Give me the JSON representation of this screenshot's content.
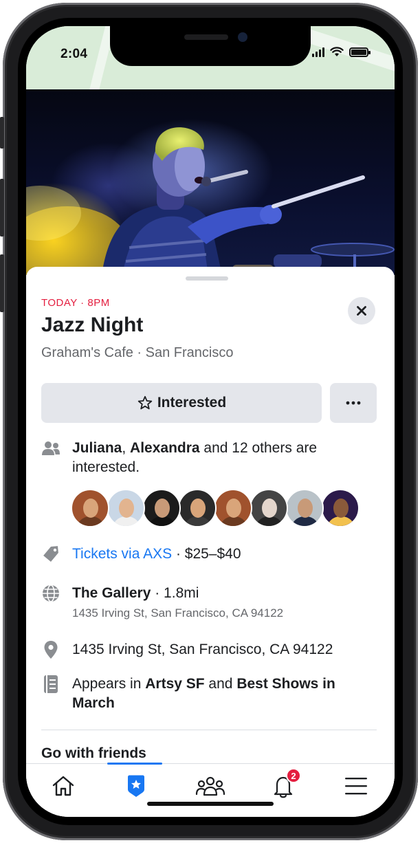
{
  "status_bar": {
    "time": "2:04"
  },
  "event": {
    "when": "TODAY · 8PM",
    "title": "Jazz Night",
    "subtitle": "Graham's Cafe · San Francisco"
  },
  "actions": {
    "interested_label": "Interested",
    "more_label": "···"
  },
  "interest": {
    "name1": "Juliana",
    "sep": ", ",
    "name2": "Alexandra",
    "rest": " and 12 others are interested."
  },
  "avatars": [
    {
      "name": "avatar-1",
      "bg": "#a0522d",
      "face": "#d9a57a",
      "body": "#6b3a20"
    },
    {
      "name": "avatar-2",
      "bg": "#c9d7e6",
      "face": "#e2b48f",
      "body": "#f0f0f0"
    },
    {
      "name": "avatar-3",
      "bg": "#1b1b1b",
      "face": "#c89a78",
      "body": "#111111"
    },
    {
      "name": "avatar-4",
      "bg": "#2a2a2a",
      "face": "#d9a57a",
      "body": "#3a3a3a"
    },
    {
      "name": "avatar-5",
      "bg": "#a0522d",
      "face": "#d9a57a",
      "body": "#6b3a20"
    },
    {
      "name": "avatar-6",
      "bg": "#444444",
      "face": "#e4d6cc",
      "body": "#222222"
    },
    {
      "name": "avatar-7",
      "bg": "#b9c2c8",
      "face": "#c89a78",
      "body": "#1f2a44"
    },
    {
      "name": "avatar-8",
      "bg": "#2b1a4a",
      "face": "#8a5a3a",
      "body": "#f2c14e"
    }
  ],
  "tickets": {
    "link": "Tickets via AXS",
    "price": " · $25–$40"
  },
  "venue": {
    "name": "The Gallery",
    "distance": " · 1.8mi",
    "address": "1435 Irving St, San Francisco, CA 94122"
  },
  "location": {
    "address": "1435 Irving St, San Francisco, CA 94122"
  },
  "appears_in": {
    "prefix": "Appears in ",
    "list1": "Artsy SF",
    "and": " and ",
    "list2": "Best Shows in March"
  },
  "section": {
    "title": "Go with friends"
  },
  "tabbar": {
    "notifications_badge": "2",
    "active_tab": "events"
  },
  "colors": {
    "accent": "#1877f2",
    "date_red": "#e41e3f",
    "button_gray": "#e4e6eb",
    "text_primary": "#1c1e21",
    "text_secondary": "#65676b"
  }
}
